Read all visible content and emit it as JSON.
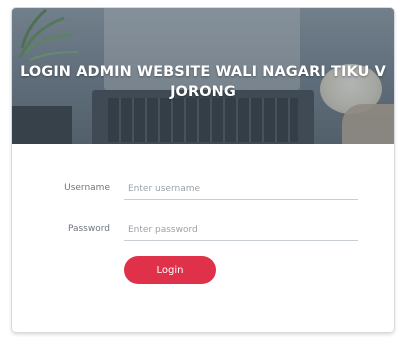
{
  "header": {
    "title": "LOGIN ADMIN WEBSITE WALI NAGARI TIKU V JORONG"
  },
  "form": {
    "username": {
      "label": "Username",
      "placeholder": "Enter username",
      "value": ""
    },
    "password": {
      "label": "Password",
      "placeholder": "Enter password",
      "value": ""
    },
    "submit_label": "Login"
  },
  "colors": {
    "accent": "#e0314a",
    "card_background": "#f4f5f7"
  }
}
